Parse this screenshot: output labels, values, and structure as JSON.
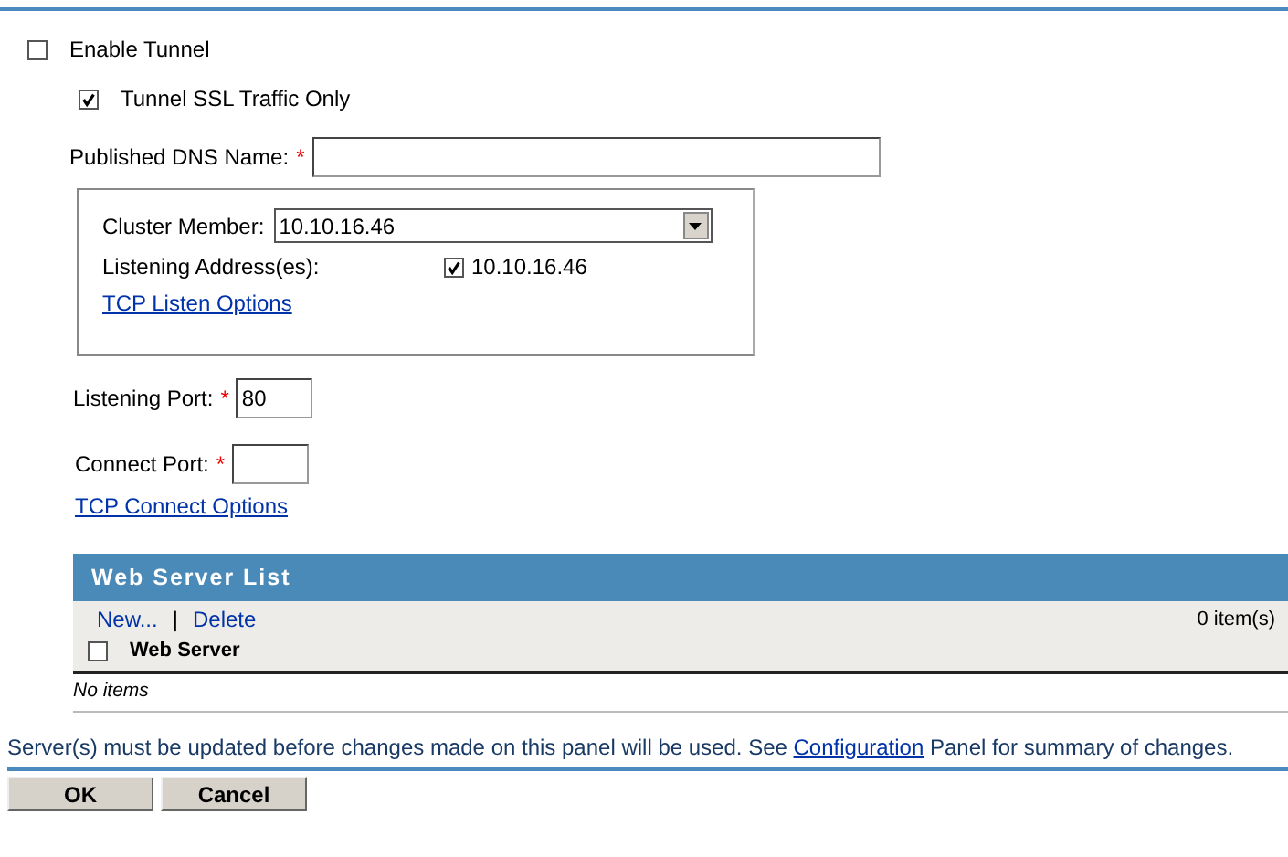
{
  "enable_tunnel": {
    "label": "Enable Tunnel",
    "checked": false
  },
  "ssl_only": {
    "label": "Tunnel SSL Traffic Only",
    "checked": true
  },
  "dns_name": {
    "label": "Published DNS Name:",
    "required_mark": "*"
  },
  "cluster_box": {
    "member_label": "Cluster Member:",
    "member_value": "10.10.16.46",
    "addresses_label": "Listening Address(es):",
    "addresses": [
      {
        "label": "10.10.16.46",
        "checked": true
      }
    ],
    "options_link": "TCP Listen Options"
  },
  "listening_port": {
    "label": "Listening Port:",
    "required_mark": "*",
    "value": "80"
  },
  "connect_port": {
    "label": "Connect Port:",
    "required_mark": "*"
  },
  "connect_options_link": "TCP Connect Options",
  "web_server_list": {
    "title": "Web Server List",
    "actions": [
      "New...",
      "Delete"
    ],
    "separator": "|",
    "count": "0 item(s)",
    "columns": [
      {
        "label": "Web Server"
      }
    ],
    "select_all": {
      "checked": false
    },
    "empty_text": "No items"
  },
  "notice": {
    "before": "Server(s) must be updated before changes made on this panel will be used. See",
    "link": "Configuration",
    "after": "Panel for summary of changes."
  },
  "buttons": [
    "OK",
    "Cancel"
  ]
}
